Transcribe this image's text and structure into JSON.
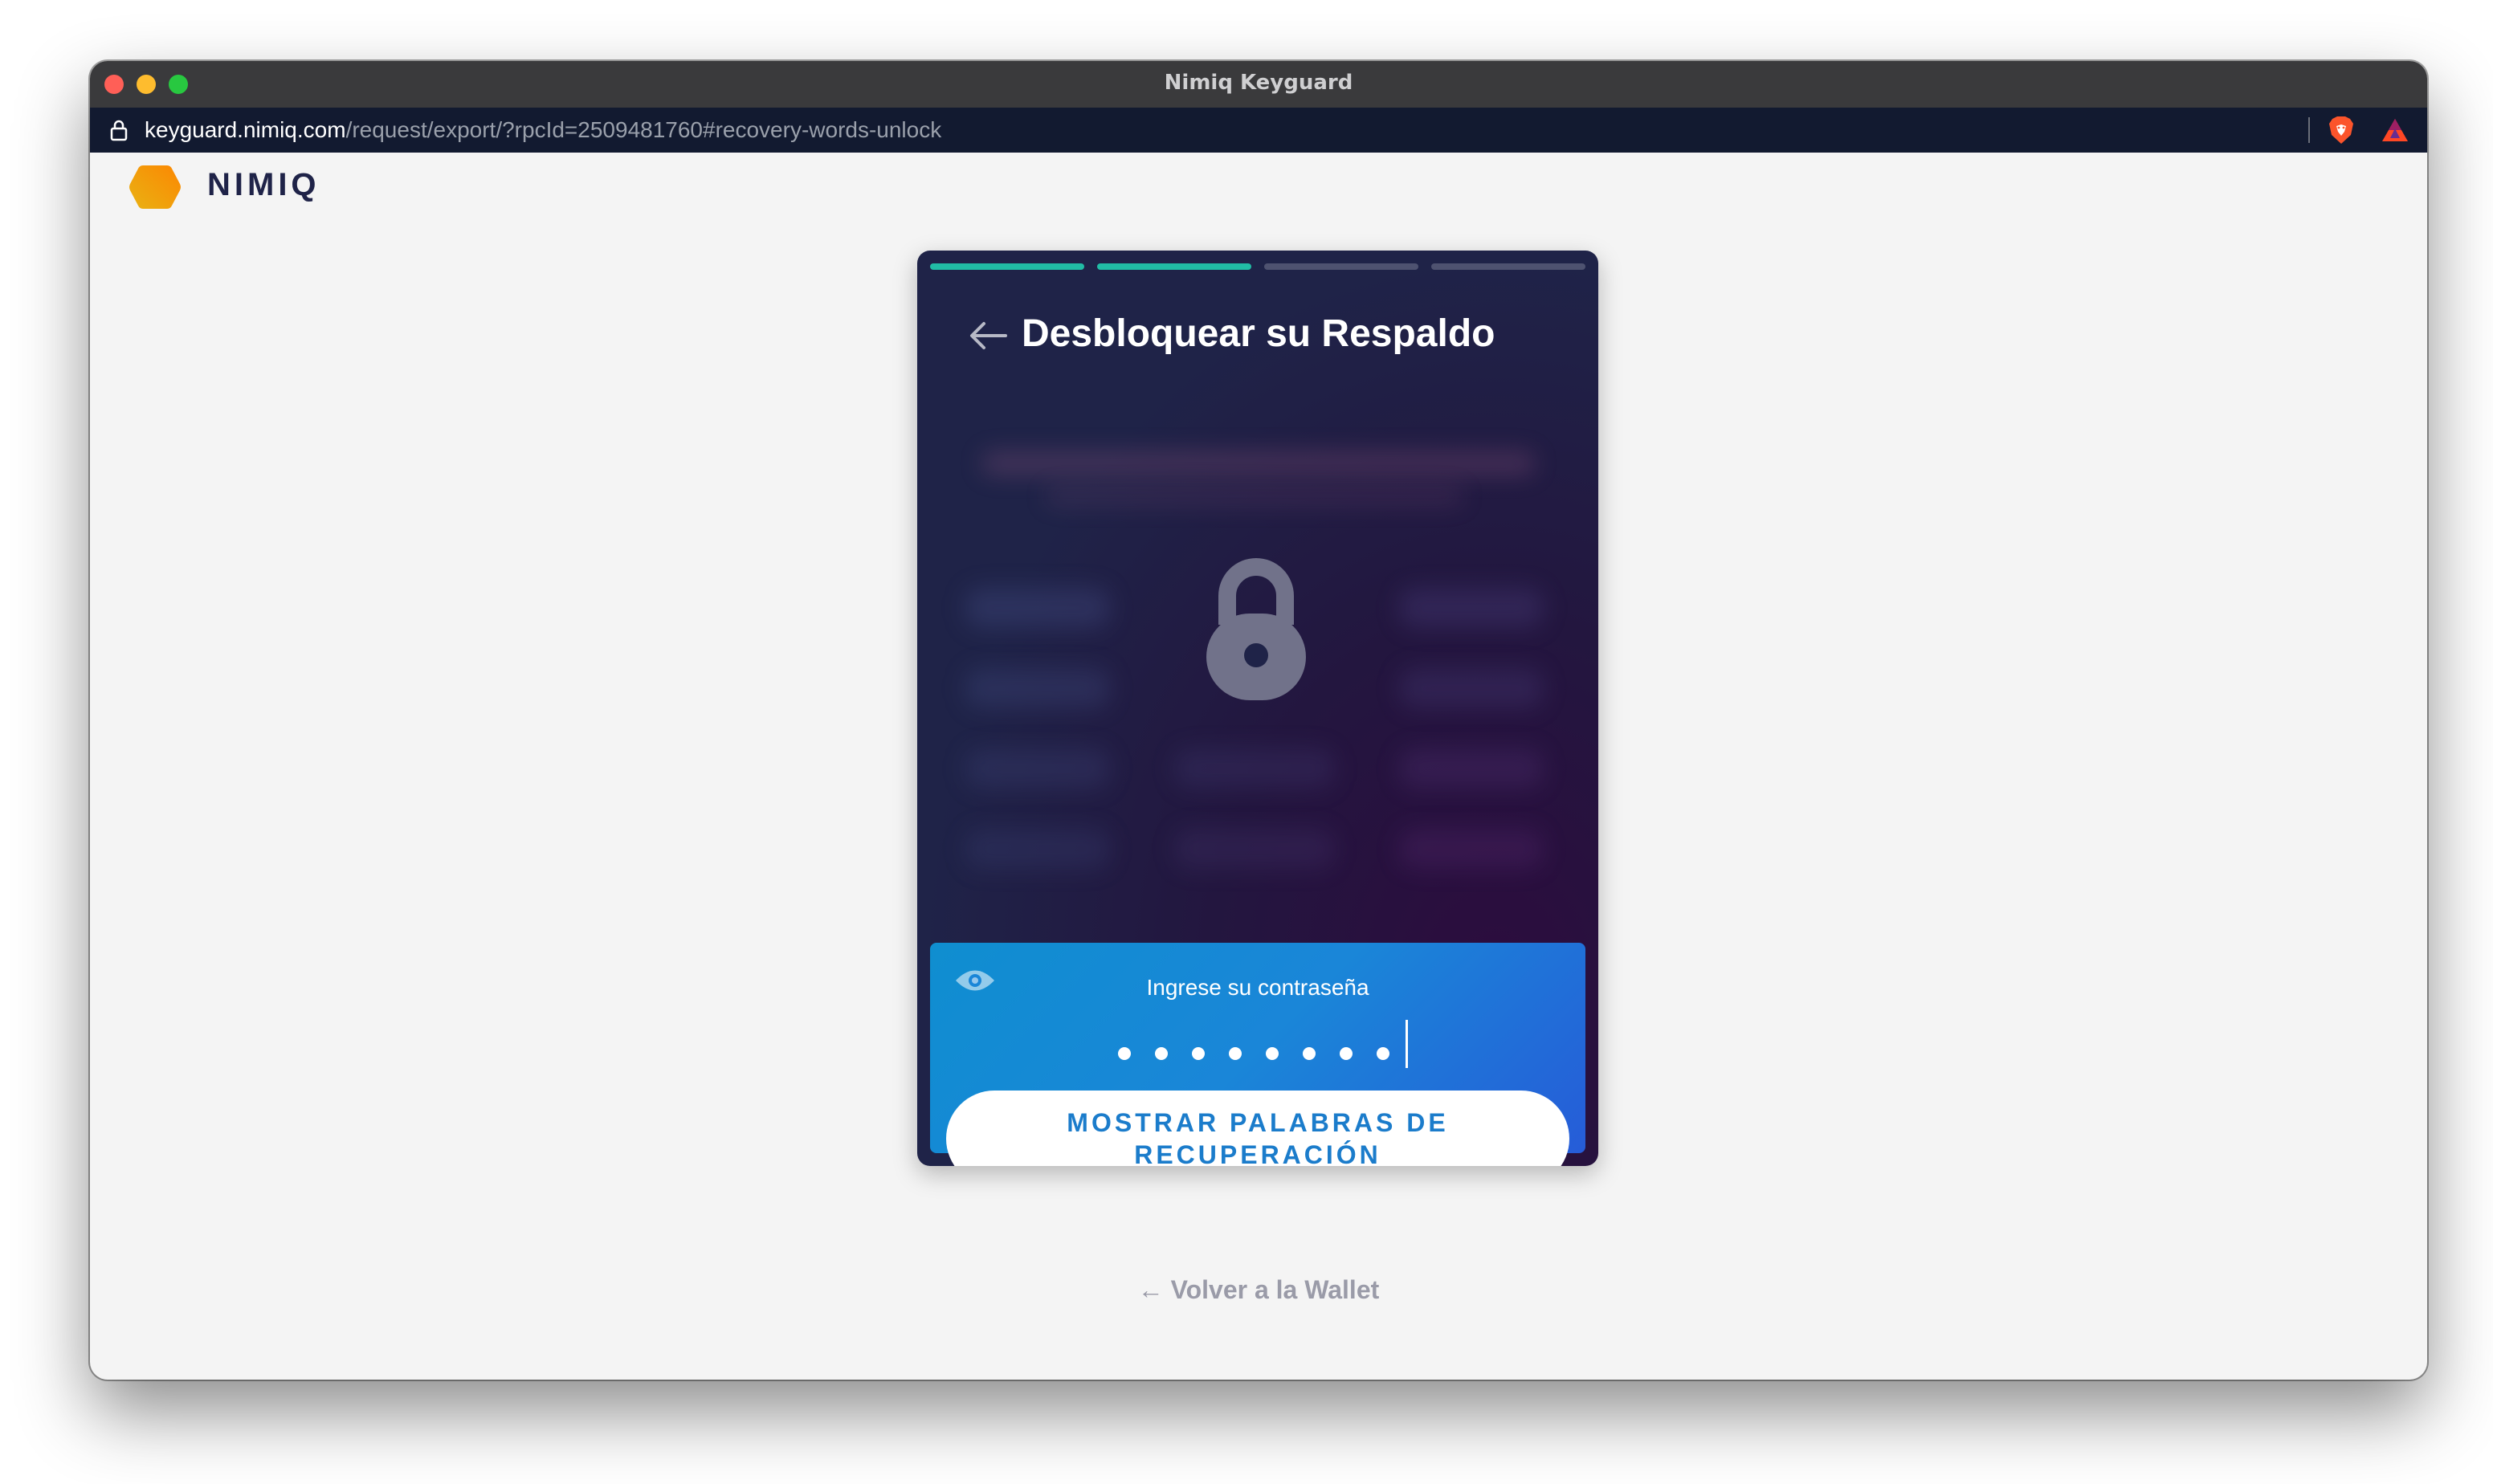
{
  "window": {
    "title": "Nimiq Keyguard"
  },
  "address_bar": {
    "host": "keyguard.nimiq.com",
    "path": "/request/export/?rpcId=2509481760#recovery-words-unlock"
  },
  "brand": {
    "name": "NIMIQ",
    "accent_color": "#f5a623"
  },
  "progress": {
    "total_steps": 4,
    "completed_steps": 2,
    "active_color": "#21bca5",
    "inactive_color": "#4e5270"
  },
  "card": {
    "title": "Desbloquear su Respaldo",
    "background_color": "#1f2348"
  },
  "password": {
    "label": "Ingrese su contraseña",
    "masked_value": "••••••••",
    "panel_color": "#1a86d8"
  },
  "buttons": {
    "reveal_label": "MOSTRAR PALABRAS DE RECUPERACIÓN",
    "return_label": "← Volver a la Wallet"
  },
  "icons": {
    "address_lock": "lock-icon",
    "brave": "brave-lion-icon",
    "bat": "bat-triangle-icon",
    "logo": "nimiq-hexagon-icon",
    "back": "arrow-left-icon",
    "locked": "padlock-icon",
    "show_password": "eye-icon"
  }
}
